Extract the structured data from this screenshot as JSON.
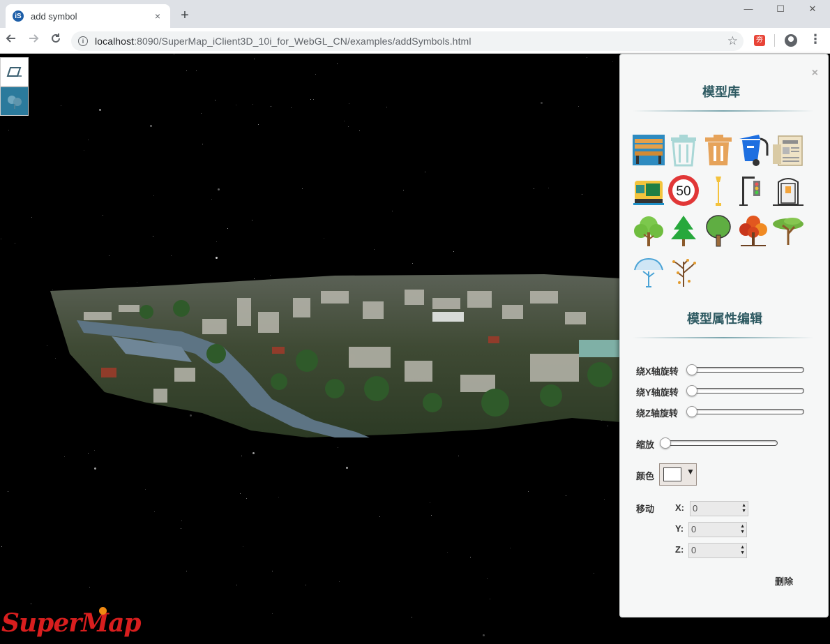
{
  "browser": {
    "tab_title": "add symbol",
    "tab_favicon_text": "iS",
    "close_glyph": "×",
    "newtab_glyph": "+",
    "url_host": "localhost",
    "url_rest": ":8090/SuperMap_iClient3D_10i_for_WebGL_CN/examples/addSymbols.html",
    "ext_badge": "夯",
    "window_controls": [
      "—",
      "☐",
      "✕"
    ]
  },
  "brand": {
    "logo_text": "SuperMap"
  },
  "panel": {
    "close_glyph": "×",
    "library_title": "模型库",
    "edit_title": "模型属性编辑",
    "symbols": [
      "bench-icon",
      "recycle-bin-icon",
      "trash-bin-icon",
      "wheelie-bin-icon",
      "newspaper-stand-icon",
      "vending-kiosk-icon",
      "speed-limit-50-icon",
      "street-lamp-icon",
      "traffic-light-icon",
      "phone-booth-icon",
      "round-tree-icon",
      "pine-tree-icon",
      "oak-tree-icon",
      "autumn-tree-icon",
      "acacia-tree-icon",
      "willow-tree-icon",
      "bare-tree-icon"
    ],
    "speed_limit_text": "50",
    "rotate_x_label": "绕X轴旋转",
    "rotate_y_label": "绕Y轴旋转",
    "rotate_z_label": "绕Z轴旋转",
    "scale_label": "缩放",
    "color_label": "颜色",
    "color_value": "#ffffff",
    "color_arrow": "▼",
    "move_label": "移动",
    "x_label": "X:",
    "y_label": "Y:",
    "z_label": "Z:",
    "x_value": "0",
    "y_value": "0",
    "z_value": "0",
    "delete_label": "删除"
  }
}
